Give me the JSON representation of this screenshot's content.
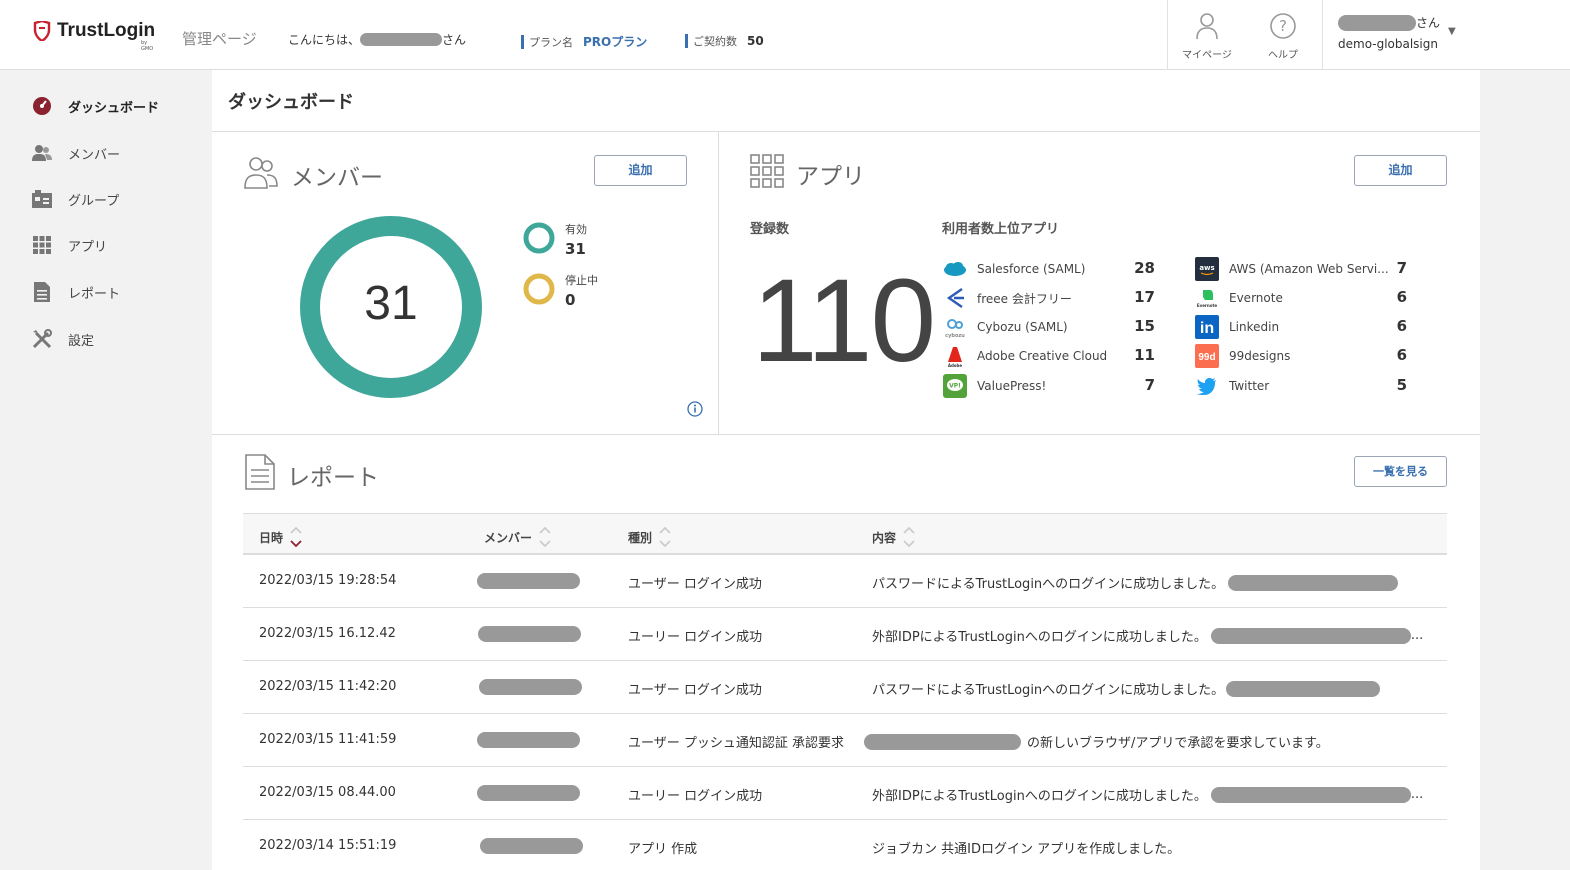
{
  "header": {
    "brand": "TrustLogin",
    "brand_by": "by GMO",
    "admin_label": "管理ページ",
    "greeting_prefix": "こんにちは、",
    "greeting_suffix": "さん",
    "plan_label": "プラン名",
    "plan_value": "PROプラン",
    "contract_label": "ご契約数",
    "contract_value": "50",
    "mypage_label": "マイページ",
    "help_label": "ヘルプ",
    "user_suffix": "さん",
    "user_org": "demo-globalsign"
  },
  "sidebar": {
    "items": [
      {
        "label": "ダッシュボード",
        "icon": "dashboard-icon"
      },
      {
        "label": "メンバー",
        "icon": "members-icon"
      },
      {
        "label": "グループ",
        "icon": "group-icon"
      },
      {
        "label": "アプリ",
        "icon": "apps-grid-icon"
      },
      {
        "label": "レポート",
        "icon": "report-icon"
      },
      {
        "label": "設定",
        "icon": "settings-tools-icon"
      }
    ]
  },
  "main": {
    "page_title": "ダッシュボード",
    "members": {
      "title": "メンバー",
      "add_label": "追加",
      "total": "31",
      "active_label": "有効",
      "active_count": "31",
      "suspended_label": "停止中",
      "suspended_count": "0",
      "colors": {
        "active": "#3fa69a",
        "suspended": "#e0b84a"
      }
    },
    "apps": {
      "title": "アプリ",
      "add_label": "追加",
      "registered_label": "登録数",
      "registered_count": "110",
      "top_label": "利用者数上位アプリ",
      "left_list": [
        {
          "name": "Salesforce (SAML)",
          "count": "28",
          "icon": "salesforce-icon"
        },
        {
          "name": "freee 会計フリー",
          "count": "17",
          "icon": "freee-icon"
        },
        {
          "name": "Cybozu (SAML)",
          "count": "15",
          "icon": "cybozu-icon"
        },
        {
          "name": "Adobe Creative Cloud",
          "count": "11",
          "icon": "adobe-icon"
        },
        {
          "name": "ValuePress!",
          "count": "7",
          "icon": "valuepress-icon"
        }
      ],
      "right_list": [
        {
          "name": "AWS (Amazon Web Servi...",
          "count": "7",
          "icon": "aws-icon"
        },
        {
          "name": "Evernote",
          "count": "6",
          "icon": "evernote-icon"
        },
        {
          "name": "Linkedin",
          "count": "6",
          "icon": "linkedin-icon"
        },
        {
          "name": "99designs",
          "count": "6",
          "icon": "99designs-icon"
        },
        {
          "name": "Twitter",
          "count": "5",
          "icon": "twitter-icon"
        }
      ]
    },
    "report": {
      "title": "レポート",
      "view_all_label": "一覧を見る",
      "columns": [
        "日時",
        "メンバー",
        "種別",
        "内容"
      ],
      "rows": [
        {
          "datetime": "2022/03/15 19:28:54",
          "type": "ユーザー ログイン成功",
          "content": "パスワードによるTrustLoginへのログインに成功しました。",
          "content_tail": ""
        },
        {
          "datetime": "2022/03/15 16.12.42",
          "type": "ユーリー ログイン成功",
          "content": "外部IDPによるTrustLoginへのログインに成功しました。",
          "content_tail": "..."
        },
        {
          "datetime": "2022/03/15 11:42:20",
          "type": "ユーザー ログイン成功",
          "content": "パスワードによるTrustLoginへのログインに成功しました。",
          "content_tail": ""
        },
        {
          "datetime": "2022/03/15 11:41:59",
          "type": "ユーザー プッシュ通知認証 承認要求",
          "content": "の新しいブラウザ/アプリで承認を要求しています。",
          "content_tail": ""
        },
        {
          "datetime": "2022/03/15 08.44.00",
          "type": "ユーリー ログイン成功",
          "content": "外部IDPによるTrustLoginへのログインに成功しました。",
          "content_tail": "..."
        },
        {
          "datetime": "2022/03/14 15:51:19",
          "type": "アプリ 作成",
          "content": "ジョブカン 共通IDログイン アプリを作成しました。",
          "content_tail": ""
        }
      ]
    }
  }
}
